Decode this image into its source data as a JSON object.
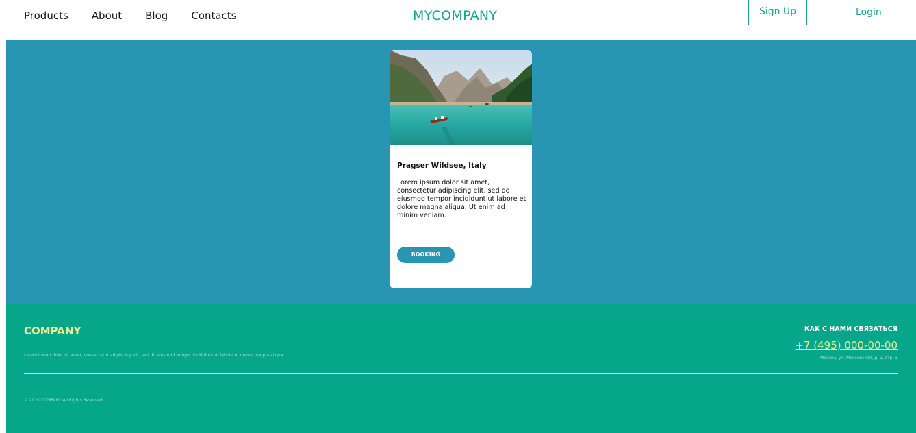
{
  "header": {
    "nav": [
      "Products",
      "About",
      "Blog",
      "Contacts"
    ],
    "brand": "MYCOMPANY",
    "signup_label": "Sign Up",
    "login_label": "Login",
    "accent_color": "#18a58d"
  },
  "hero": {
    "background_color": "#2896b3",
    "card": {
      "image_icon": "lake-mountains-photo",
      "title": "Pragser Wildsee, Italy",
      "text": "Lorem ipsum dolor sit amet, consectetur adipiscing elit, sed do eiusmod tempor incididunt ut labore et dolore magna aliqua. Ut enim ad minim veniam.",
      "button_label": "BOOKING"
    }
  },
  "footer": {
    "background_color": "#05a689",
    "company": "COMPANY",
    "description": "Lorem ipsum dolor sit amet, consectetur adipiscing elit, sed do eiusmod tempor incididunt ut labore et dolore magna aliqua.",
    "contact_title": "КАК С НАМИ СВЯЗАТЬСЯ",
    "phone": "+7 (495) 000-00-00",
    "address": "Москва, ул. Московская, д. 2, стр. 1",
    "copyright": "© 2021 COMPANY All Rights Reserved."
  }
}
